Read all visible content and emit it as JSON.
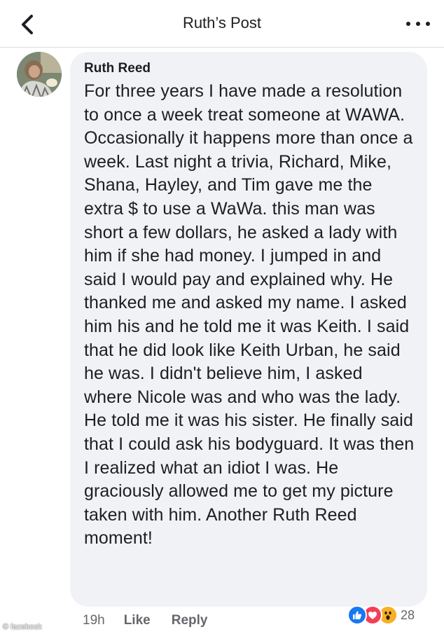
{
  "header": {
    "title": "Ruth’s Post"
  },
  "comment": {
    "author": "Ruth Reed",
    "text": "For three years I have made a resolution to once a week treat someone at WAWA. Occasionally it happens more than once a week. Last night a trivia, Richard, Mike, Shana, Hayley, and Tim gave me the extra $ to use a WaWa. this man was short a few dollars, he asked a lady with him if she had money. I jumped in and said I would pay and explained why. He thanked me and asked my name. I asked him his and he told me it was Keith. I said that he did look like Keith Urban, he said he was. I didn't believe him, I asked where Nicole was and who was the lady. He told me it was his sister. He finally said that I could ask his bodyguard. It was then I realized what an idiot I was. He graciously allowed me to get my picture taken with him. Another Ruth Reed moment!",
    "time": "19h",
    "like_label": "Like",
    "reply_label": "Reply",
    "reactions": {
      "icons": [
        "like-icon",
        "love-icon",
        "wow-icon"
      ],
      "count": "28"
    }
  },
  "watermark": "© facebook",
  "colors": {
    "bubble": "#f0f2f5",
    "secondary_text": "#65676b",
    "like": "#1877f2",
    "love": "#f33e58",
    "wow": "#f7b125"
  }
}
